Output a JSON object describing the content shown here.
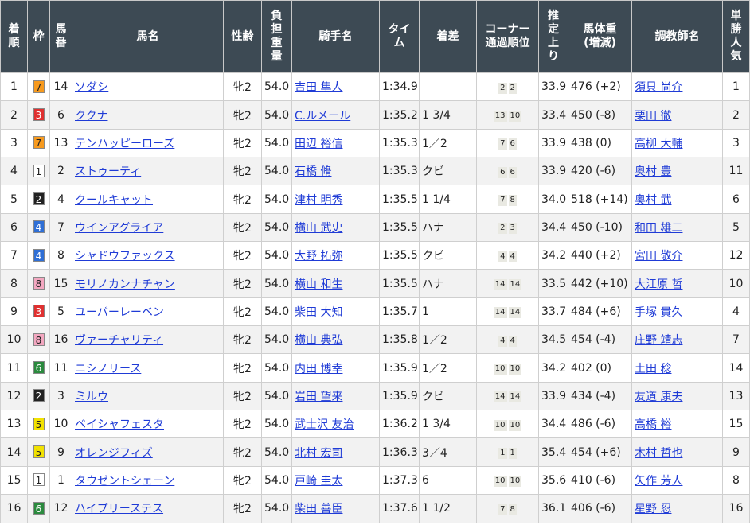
{
  "headers": [
    "着順",
    "枠",
    "馬番",
    "馬名",
    "性齢",
    "負担重量",
    "騎手名",
    "タイム",
    "着差",
    "コーナー通過順位",
    "推定上り",
    "馬体重(増減)",
    "調教師名",
    "単勝人気"
  ],
  "rows": [
    {
      "rank": "1",
      "waku": "7",
      "num": "14",
      "horse": "ソダシ",
      "sex": "牝2",
      "weight": "54.0",
      "jockey": "吉田 隼人",
      "time": "1:34.9",
      "margin": "",
      "corner": [
        "2",
        "2"
      ],
      "last": "33.9",
      "body": "476 (+2)",
      "trainer": "須貝 尚介",
      "pop": "1"
    },
    {
      "rank": "2",
      "waku": "3",
      "num": "6",
      "horse": "ククナ",
      "sex": "牝2",
      "weight": "54.0",
      "jockey": "C.ルメール",
      "time": "1:35.2",
      "margin": "1 3/4",
      "corner": [
        "13",
        "10"
      ],
      "last": "33.4",
      "body": "450 (-8)",
      "trainer": "栗田 徹",
      "pop": "2"
    },
    {
      "rank": "3",
      "waku": "7",
      "num": "13",
      "horse": "テンハッピーローズ",
      "sex": "牝2",
      "weight": "54.0",
      "jockey": "田辺 裕信",
      "time": "1:35.3",
      "margin": "1／2",
      "corner": [
        "7",
        "6"
      ],
      "last": "33.9",
      "body": "438 (0)",
      "trainer": "高柳 大輔",
      "pop": "3"
    },
    {
      "rank": "4",
      "waku": "1",
      "num": "2",
      "horse": "ストゥーティ",
      "sex": "牝2",
      "weight": "54.0",
      "jockey": "石橋 脩",
      "time": "1:35.3",
      "margin": "クビ",
      "corner": [
        "6",
        "6"
      ],
      "last": "33.9",
      "body": "420 (-6)",
      "trainer": "奥村 豊",
      "pop": "11"
    },
    {
      "rank": "5",
      "waku": "2",
      "num": "4",
      "horse": "クールキャット",
      "sex": "牝2",
      "weight": "54.0",
      "jockey": "津村 明秀",
      "time": "1:35.5",
      "margin": "1 1/4",
      "corner": [
        "7",
        "8"
      ],
      "last": "34.0",
      "body": "518 (+14)",
      "trainer": "奥村 武",
      "pop": "6"
    },
    {
      "rank": "6",
      "waku": "4",
      "num": "7",
      "horse": "ウインアグライア",
      "sex": "牝2",
      "weight": "54.0",
      "jockey": "横山 武史",
      "time": "1:35.5",
      "margin": "ハナ",
      "corner": [
        "2",
        "3"
      ],
      "last": "34.4",
      "body": "450 (-10)",
      "trainer": "和田 雄二",
      "pop": "5"
    },
    {
      "rank": "7",
      "waku": "4",
      "num": "8",
      "horse": "シャドウファックス",
      "sex": "牝2",
      "weight": "54.0",
      "jockey": "大野 拓弥",
      "time": "1:35.5",
      "margin": "クビ",
      "corner": [
        "4",
        "4"
      ],
      "last": "34.2",
      "body": "440 (+2)",
      "trainer": "宮田 敬介",
      "pop": "12"
    },
    {
      "rank": "8",
      "waku": "8",
      "num": "15",
      "horse": "モリノカンナチャン",
      "sex": "牝2",
      "weight": "54.0",
      "jockey": "横山 和生",
      "time": "1:35.5",
      "margin": "ハナ",
      "corner": [
        "14",
        "14"
      ],
      "last": "33.5",
      "body": "442 (+10)",
      "trainer": "大江原 哲",
      "pop": "10"
    },
    {
      "rank": "9",
      "waku": "3",
      "num": "5",
      "horse": "ユーバーレーベン",
      "sex": "牝2",
      "weight": "54.0",
      "jockey": "柴田 大知",
      "time": "1:35.7",
      "margin": "1",
      "corner": [
        "14",
        "14"
      ],
      "last": "33.7",
      "body": "484 (+6)",
      "trainer": "手塚 貴久",
      "pop": "4"
    },
    {
      "rank": "10",
      "waku": "8",
      "num": "16",
      "horse": "ヴァーチャリティ",
      "sex": "牝2",
      "weight": "54.0",
      "jockey": "横山 典弘",
      "time": "1:35.8",
      "margin": "1／2",
      "corner": [
        "4",
        "4"
      ],
      "last": "34.5",
      "body": "454 (-4)",
      "trainer": "庄野 靖志",
      "pop": "7"
    },
    {
      "rank": "11",
      "waku": "6",
      "num": "11",
      "horse": "ニシノリース",
      "sex": "牝2",
      "weight": "54.0",
      "jockey": "内田 博幸",
      "time": "1:35.9",
      "margin": "1／2",
      "corner": [
        "10",
        "10"
      ],
      "last": "34.2",
      "body": "402 (0)",
      "trainer": "土田 稔",
      "pop": "14"
    },
    {
      "rank": "12",
      "waku": "2",
      "num": "3",
      "horse": "ミルウ",
      "sex": "牝2",
      "weight": "54.0",
      "jockey": "岩田 望来",
      "time": "1:35.9",
      "margin": "クビ",
      "corner": [
        "14",
        "14"
      ],
      "last": "33.9",
      "body": "434 (-4)",
      "trainer": "友道 康夫",
      "pop": "13"
    },
    {
      "rank": "13",
      "waku": "5",
      "num": "10",
      "horse": "ペイシャフェスタ",
      "sex": "牝2",
      "weight": "54.0",
      "jockey": "武士沢 友治",
      "time": "1:36.2",
      "margin": "1 3/4",
      "corner": [
        "10",
        "10"
      ],
      "last": "34.4",
      "body": "486 (-6)",
      "trainer": "高橋 裕",
      "pop": "15"
    },
    {
      "rank": "14",
      "waku": "5",
      "num": "9",
      "horse": "オレンジフィズ",
      "sex": "牝2",
      "weight": "54.0",
      "jockey": "北村 宏司",
      "time": "1:36.3",
      "margin": "3／4",
      "corner": [
        "1",
        "1"
      ],
      "last": "35.4",
      "body": "454 (+6)",
      "trainer": "木村 哲也",
      "pop": "9"
    },
    {
      "rank": "15",
      "waku": "1",
      "num": "1",
      "horse": "タウゼントシェーン",
      "sex": "牝2",
      "weight": "54.0",
      "jockey": "戸崎 圭太",
      "time": "1:37.3",
      "margin": "6",
      "corner": [
        "10",
        "10"
      ],
      "last": "35.6",
      "body": "410 (-6)",
      "trainer": "矢作 芳人",
      "pop": "8"
    },
    {
      "rank": "16",
      "waku": "6",
      "num": "12",
      "horse": "ハイプリーステス",
      "sex": "牝2",
      "weight": "54.0",
      "jockey": "柴田 善臣",
      "time": "1:37.6",
      "margin": "1 1/2",
      "corner": [
        "7",
        "8"
      ],
      "last": "36.1",
      "body": "406 (-6)",
      "trainer": "星野 忍",
      "pop": "16"
    }
  ],
  "waku_colors": {
    "1": {
      "bg": "#ffffff",
      "fg": "#222222"
    },
    "2": {
      "bg": "#222222",
      "fg": "#ffffff"
    },
    "3": {
      "bg": "#e03030",
      "fg": "#ffffff"
    },
    "4": {
      "bg": "#2f6fd6",
      "fg": "#ffffff"
    },
    "5": {
      "bg": "#f2e200",
      "fg": "#222222"
    },
    "6": {
      "bg": "#2b8a3e",
      "fg": "#ffffff"
    },
    "7": {
      "bg": "#f79a1e",
      "fg": "#222222"
    },
    "8": {
      "bg": "#f3a7c0",
      "fg": "#222222"
    }
  }
}
